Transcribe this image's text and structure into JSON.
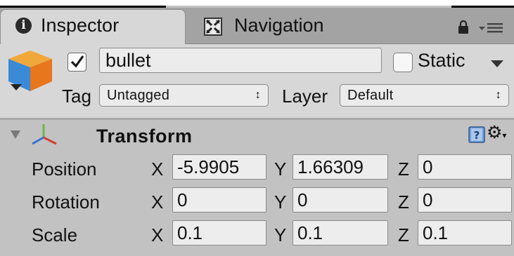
{
  "tabs": {
    "inspector_label": "Inspector",
    "navigation_label": "Navigation"
  },
  "object": {
    "active": true,
    "name": "bullet",
    "static_label": "Static",
    "static_checked": false,
    "tag_label": "Tag",
    "tag_value": "Untagged",
    "layer_label": "Layer",
    "layer_value": "Default"
  },
  "transform": {
    "title": "Transform",
    "rows": [
      {
        "label": "Position",
        "x": "-5.9905",
        "y": "1.66309",
        "z": "0"
      },
      {
        "label": "Rotation",
        "x": "0",
        "y": "0",
        "z": "0"
      },
      {
        "label": "Scale",
        "x": "0.1",
        "y": "0.1",
        "z": "0.1"
      }
    ],
    "axis_x": "X",
    "axis_y": "Y",
    "axis_z": "Z"
  },
  "icons": {
    "tab_inspector": "info-icon",
    "tab_navigation": "navigation-icon",
    "lock": "lock-icon",
    "menu": "menu-icon",
    "object": "cube-icon",
    "transform": "axes-icon",
    "help": "help-icon",
    "settings": "gear-icon"
  },
  "colors": {
    "background": "#c2c2c2",
    "header_bg": "#d7d7d7",
    "check_blue": "#1e5fbf",
    "cube_orange": "#e8761c",
    "cube_blue": "#3a8ad8",
    "cube_green": "#6cc13a"
  }
}
